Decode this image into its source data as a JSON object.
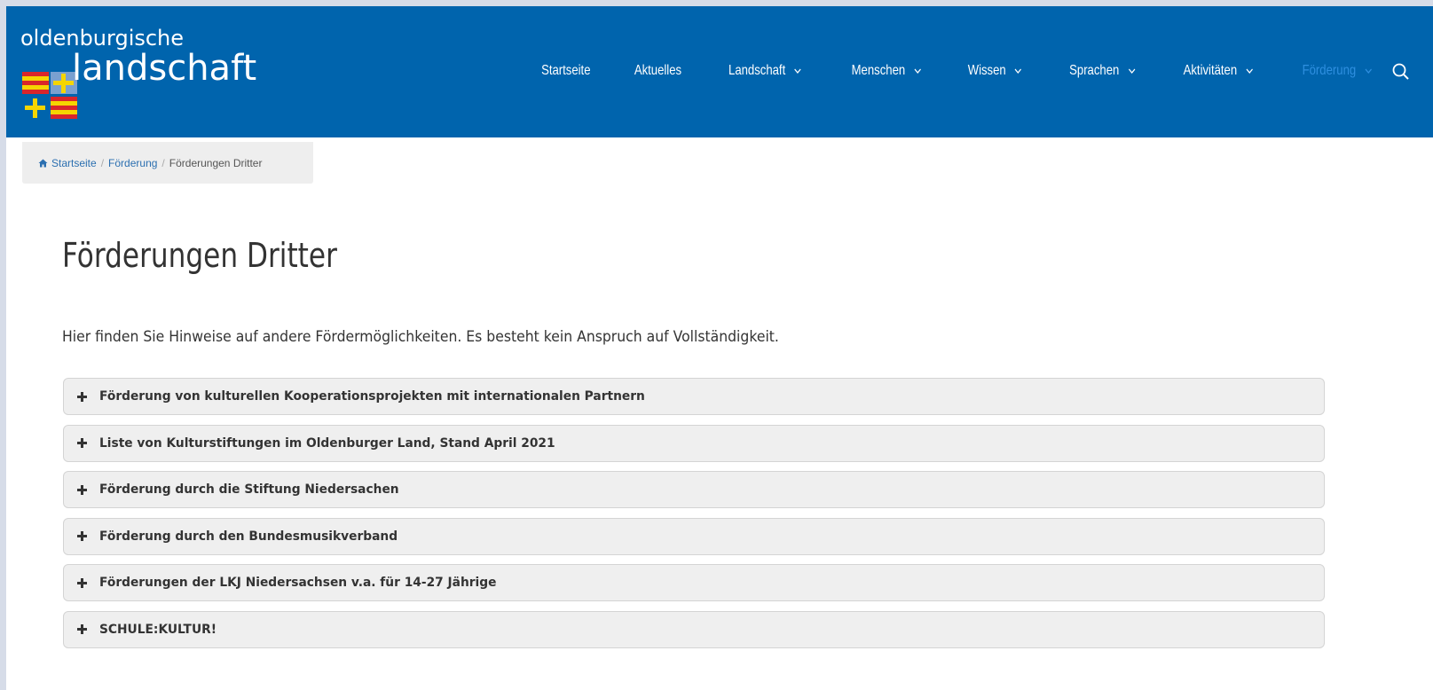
{
  "logo": {
    "line1": "oldenburgische",
    "line2": "landschaft"
  },
  "nav": {
    "items": [
      {
        "label": "Startseite",
        "dropdown": false,
        "active": false
      },
      {
        "label": "Aktuelles",
        "dropdown": false,
        "active": false
      },
      {
        "label": "Landschaft",
        "dropdown": true,
        "active": false
      },
      {
        "label": "Menschen",
        "dropdown": true,
        "active": false
      },
      {
        "label": "Wissen",
        "dropdown": true,
        "active": false
      },
      {
        "label": "Sprachen",
        "dropdown": true,
        "active": false
      },
      {
        "label": "Aktivitäten",
        "dropdown": true,
        "active": false
      },
      {
        "label": "Förderung",
        "dropdown": true,
        "active": true
      }
    ],
    "search_icon": "search-icon"
  },
  "breadcrumb": {
    "home_icon": "home-icon",
    "items": [
      "Startseite",
      "Förderung",
      "Förderungen Dritter"
    ],
    "separator": "/"
  },
  "page": {
    "title": "Förderungen Dritter",
    "intro": "Hier finden Sie Hinweise auf andere Fördermöglichkeiten. Es besteht kein Anspruch auf Vollständigkeit."
  },
  "accordion": {
    "items": [
      "Förderung von kulturellen Kooperationsprojekten mit internationalen Partnern",
      "Liste von Kulturstiftungen im Oldenburger Land, Stand April 2021",
      "Förderung durch die Stiftung Niedersachen",
      "Förderung durch den Bundesmusikverband",
      "Förderungen der LKJ Niedersachsen v.a. für 14-27 Jährige",
      "SCHULE:KULTUR!"
    ],
    "expand_icon": "plus-icon"
  },
  "colors": {
    "header_bg": "#0064ad",
    "nav_active": "#2e8fe0",
    "flag_yellow": "#f5d500",
    "flag_red": "#d9262b",
    "link": "#2b6fb0"
  }
}
